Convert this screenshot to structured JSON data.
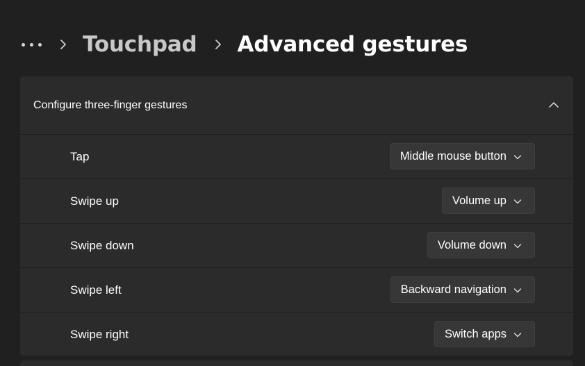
{
  "breadcrumb": {
    "more_icon": "more-dots-icon",
    "separator_icon": "chevron-right-icon",
    "parent": "Touchpad",
    "current": "Advanced gestures"
  },
  "section": {
    "title": "Configure three-finger gestures",
    "expanded": true,
    "collapse_icon": "chevron-up-icon",
    "rows": [
      {
        "label": "Tap",
        "value": "Middle mouse button"
      },
      {
        "label": "Swipe up",
        "value": "Volume up"
      },
      {
        "label": "Swipe down",
        "value": "Volume down"
      },
      {
        "label": "Swipe left",
        "value": "Backward navigation"
      },
      {
        "label": "Swipe right",
        "value": "Switch apps"
      }
    ]
  },
  "colors": {
    "background": "#202020",
    "card": "#2b2b2b",
    "dropdown": "#373737",
    "text": "#ffffff",
    "muted_text": "#c8c8c8"
  }
}
